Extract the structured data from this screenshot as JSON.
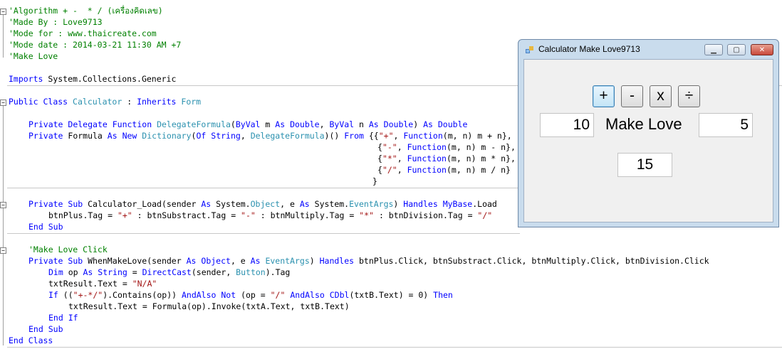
{
  "code": {
    "c1": "'Algorithm + -  * / (เครื่องคิดเลข)",
    "c2": "'Made By : Love9713",
    "c3": "'Mode for : www.thaicreate.com",
    "c4": "'Mode date : 2014-03-21 11:30 AM +7",
    "c5": "'Make Love",
    "imports_kw": "Imports",
    "imports_ns": " System.Collections.Generic",
    "cls_public": "Public",
    "cls_class": "Class",
    "cls_name": "Calculator",
    "cls_colon": " : ",
    "cls_inherits": "Inherits",
    "cls_form": "Form",
    "d_private": "Private",
    "d_delegate": "Delegate",
    "d_function": "Function",
    "d_name": "DelegateFormula",
    "d_open": "(",
    "d_byval1": "ByVal",
    "d_m": " m ",
    "d_as1": "As",
    "d_double1": "Double",
    "d_comma": ", ",
    "d_byval2": "ByVal",
    "d_n": " n ",
    "d_as2": "As",
    "d_double2": "Double",
    "d_close": ") ",
    "d_as3": "As",
    "d_double3": "Double",
    "f_private": "Private",
    "f_formula": " Formula ",
    "f_as": "As",
    "f_new": "New",
    "f_dictionary": "Dictionary",
    "f_of_open": "(",
    "f_of": "Of",
    "f_string": "String",
    "f_comma": ", ",
    "f_delegate": "DelegateFormula",
    "f_close": ")() ",
    "f_from": "From",
    "f_brace": " {{",
    "r1_str": "\"+\"",
    "r1_comma": ", ",
    "r1_fn": "Function",
    "r1_body": "(m, n) m + n},",
    "r2_brace": "{",
    "r2_str": "\"-\"",
    "r2_comma": ", ",
    "r2_fn": "Function",
    "r2_body": "(m, n) m - n},",
    "r3_brace": "{",
    "r3_str": "\"*\"",
    "r3_comma": ", ",
    "r3_fn": "Function",
    "r3_body": "(m, n) m * n},",
    "r4_brace": "{",
    "r4_str": "\"/\"",
    "r4_comma": ", ",
    "r4_fn": "Function",
    "r4_body": "(m, n) m / n}",
    "end_brace": "}",
    "l_private": "Private",
    "l_sub": "Sub",
    "l_name": " Calculator_Load(sender ",
    "l_as1": "As",
    "l_sys1": " System.",
    "l_object": "Object",
    "l_e": ", e ",
    "l_as2": "As",
    "l_sys2": " System.",
    "l_eventargs": "EventArgs",
    "l_close": ") ",
    "l_handles": "Handles",
    "l_mybase": "MyBase",
    "l_load": ".Load",
    "t_a": "btnPlus.Tag = ",
    "t_s1": "\"+\"",
    "t_b": " : btnSubstract.Tag = ",
    "t_s2": "\"-\"",
    "t_c": " : btnMultiply.Tag = ",
    "t_s3": "\"*\"",
    "t_d": " : btnDivision.Tag = ",
    "t_s4": "\"/\"",
    "es1_end": "End",
    "es1_sub": "Sub",
    "c6": "'Make Love Click",
    "w_private": "Private",
    "w_sub": "Sub",
    "w_name": " WhenMakeLove(sender ",
    "w_as1": "As",
    "w_object": "Object",
    "w_e": ", e ",
    "w_as2": "As",
    "w_eventargs": "EventArgs",
    "w_close": ") ",
    "w_handles": "Handles",
    "w_rest": " btnPlus.Click, btnSubstract.Click, btnMultiply.Click, btnDivision.Click",
    "o_dim": "Dim",
    "o_op": " op ",
    "o_as": "As",
    "o_string": "String",
    "o_eq": " = ",
    "o_dc": "DirectCast",
    "o_open": "(sender, ",
    "o_button": "Button",
    "o_tag": ").Tag",
    "n_a": "txtResult.Text = ",
    "n_str": "\"N/A\"",
    "i_if": "If",
    "i_a": " ((",
    "i_str": "\"+-*/\"",
    "i_b": ").Contains(op)) ",
    "i_andalso1": "AndAlso",
    "i_not": "Not",
    "i_c": " (op = ",
    "i_str2": "\"/\"",
    "i_andalso2": "AndAlso",
    "i_cdbl": "CDbl",
    "i_d": "(txtB.Text) = 0) ",
    "i_then": "Then",
    "x_line": "txtResult.Text = Formula(op).Invoke(txtA.Text, txtB.Text)",
    "ei_end": "End",
    "ei_if": "If",
    "es2_end": "End",
    "es2_sub": "Sub",
    "ec_end": "End",
    "ec_class": "Class"
  },
  "window": {
    "title": "Calculator Make Love9713",
    "buttons": {
      "plus": "+",
      "minus": "-",
      "multiply": "x",
      "divide": "÷"
    },
    "txtA": "10",
    "label": "Make Love",
    "txtB": "5",
    "result": "15"
  }
}
